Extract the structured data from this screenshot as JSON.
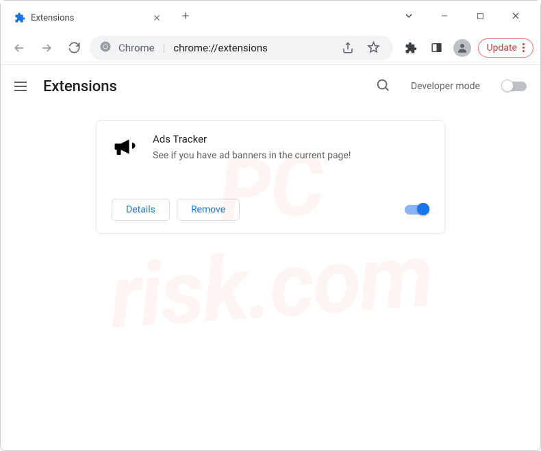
{
  "tab": {
    "title": "Extensions"
  },
  "omnibox": {
    "prefix": "Chrome",
    "path": "chrome://extensions"
  },
  "toolbar": {
    "update_label": "Update"
  },
  "page": {
    "title": "Extensions",
    "developer_mode_label": "Developer mode"
  },
  "extension": {
    "name": "Ads Tracker",
    "description": "See if you have ad banners in the current page!",
    "details_label": "Details",
    "remove_label": "Remove",
    "enabled": true
  },
  "watermark": {
    "line1": "PC",
    "line2": "risk.com"
  }
}
